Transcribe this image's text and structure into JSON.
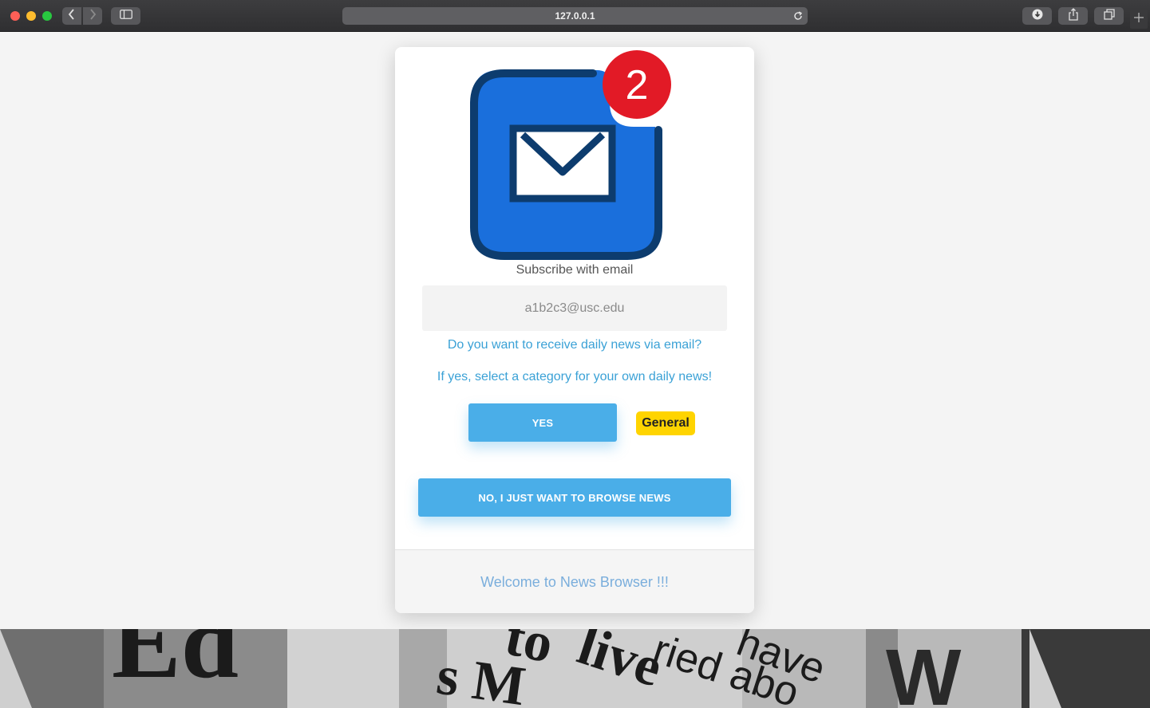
{
  "browser": {
    "url": "127.0.0.1"
  },
  "modal": {
    "badge_count": "2",
    "subtitle": "Subscribe with email",
    "email_value": "a1b2c3@usc.edu",
    "question": "Do you want to receive daily news via email?",
    "instruction": "If yes, select a category for your own daily news!",
    "yes_label": "YES",
    "category": "General",
    "no_label": "NO, I JUST WANT TO BROWSE NEWS",
    "footer": "Welcome to News Browser !!!"
  },
  "banner": {
    "words": [
      "Ed",
      "to",
      "live",
      "s M",
      "ried abo",
      "have",
      "W"
    ]
  },
  "colors": {
    "accent": "#4aaee8",
    "link": "#3aa1d6",
    "badge": "#e21a26",
    "mail_fill": "#1a6fdc",
    "mail_outline": "#0d3c6e",
    "category_bg": "#ffd400"
  }
}
